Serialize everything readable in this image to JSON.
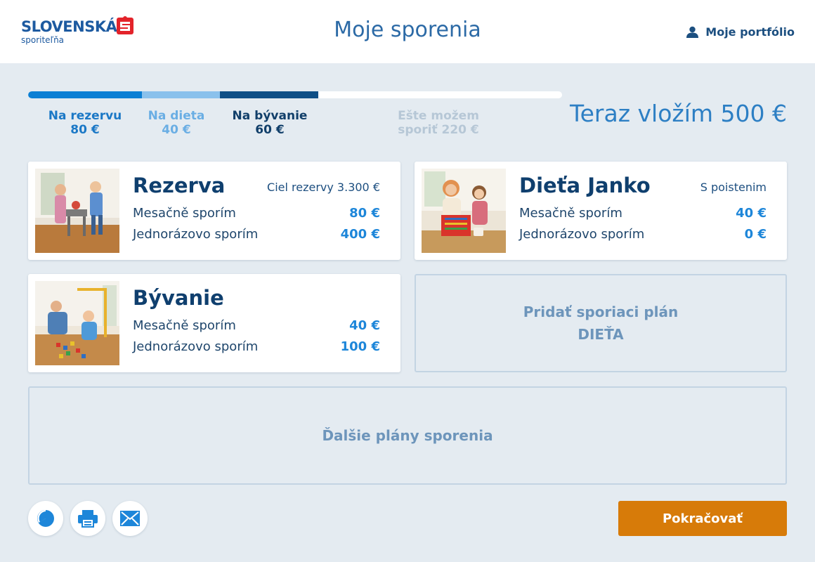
{
  "header": {
    "logo_main": "SLOVENSKÁ",
    "logo_sub": "sporiteľňa",
    "title": "Moje sporenia",
    "portfolio_label": "Moje portfólio"
  },
  "progress": {
    "segments": [
      {
        "label": "Na rezervu",
        "amount": "80 €",
        "color": "#0b7fd4"
      },
      {
        "label": "Na dieta",
        "amount": "40 €",
        "color": "#8ac1ec"
      },
      {
        "label": "Na bývanie",
        "amount": "60 €",
        "color": "#0f4f86"
      }
    ],
    "remaining_line1": "Ešte možem",
    "remaining_line2": "sporiť 220 €",
    "deposit_text": "Teraz vložím 500 €"
  },
  "cards": [
    {
      "title": "Rezerva",
      "note": "Ciel rezervy 3.300 €",
      "monthly_label": "Mesačně sporím",
      "monthly_value": "80 €",
      "onetime_label": "Jednorázovo sporím",
      "onetime_value": "400 €"
    },
    {
      "title": "Dieťa Janko",
      "note": "S poistenim",
      "monthly_label": "Mesačně sporím",
      "monthly_value": "40 €",
      "onetime_label": "Jednorázovo sporím",
      "onetime_value": "0 €"
    },
    {
      "title": "Bývanie",
      "note": "",
      "monthly_label": "Mesačně sporím",
      "monthly_value": "40 €",
      "onetime_label": "Jednorázovo sporím",
      "onetime_value": "100 €"
    }
  ],
  "add_plan": {
    "line1": "Pridať sporiaci plán",
    "line2": "DIEŤA"
  },
  "more_plans_label": "Ďalšie plány sporenia",
  "footer": {
    "icons": [
      "pie-chart-icon",
      "printer-icon",
      "envelope-icon"
    ],
    "continue_label": "Pokračovať"
  },
  "colors": {
    "accent_blue": "#1d86d9",
    "dark_blue": "#0f3f6e",
    "button_orange": "#d77b09",
    "brand_red": "#e3232a"
  }
}
